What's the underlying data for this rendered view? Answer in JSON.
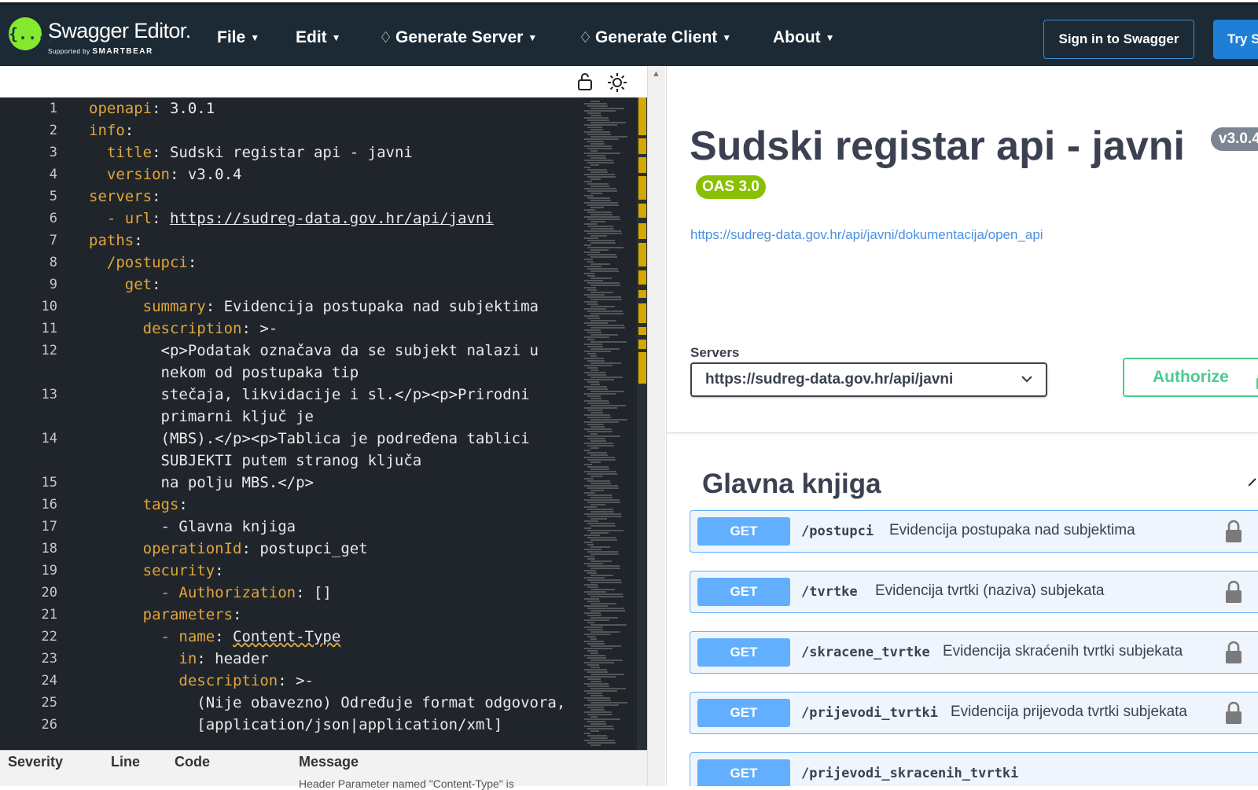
{
  "nav": {
    "logo_glyph": "{...}",
    "brand": "Swagger Editor.",
    "brand_sub": "Supported by",
    "brand_sub_bold": "SMARTBEAR",
    "items": [
      {
        "label": "File",
        "gem": ""
      },
      {
        "label": "Edit",
        "gem": ""
      },
      {
        "label": "Generate Server",
        "gem": "♢"
      },
      {
        "label": "Generate Client",
        "gem": "♢"
      },
      {
        "label": "About",
        "gem": ""
      }
    ],
    "signin": "Sign in to Swagger",
    "try": "Try S"
  },
  "editor": {
    "lock_icon": "unlock-icon",
    "theme_icon": "sun-icon",
    "lines": [
      {
        "n": "1",
        "indent": "",
        "key": "openapi",
        "rest": ": 3.0.1"
      },
      {
        "n": "2",
        "indent": "",
        "key": "info",
        "rest": ":"
      },
      {
        "n": "3",
        "indent": "  ",
        "key": "title",
        "rest": ": Sudski registar api - javni"
      },
      {
        "n": "4",
        "indent": "  ",
        "key": "version",
        "rest": ": v3.0.4"
      },
      {
        "n": "5",
        "indent": "",
        "key": "servers",
        "rest": ":"
      },
      {
        "n": "6",
        "indent": "  ",
        "key": "- url",
        "rest": ": ",
        "link": "https://sudreg-data.gov.hr/api/javni"
      },
      {
        "n": "7",
        "indent": "",
        "key": "paths",
        "rest": ":"
      },
      {
        "n": "8",
        "indent": "  ",
        "key": "/postupci",
        "rest": ":"
      },
      {
        "n": "9",
        "indent": "    ",
        "key": "get",
        "rest": ":"
      },
      {
        "n": "10",
        "indent": "      ",
        "key": "summary",
        "rest": ": Evidencija postupaka nad subjektima"
      },
      {
        "n": "11",
        "indent": "      ",
        "key": "description",
        "rest": ": >-"
      },
      {
        "n": "12",
        "indent": "        ",
        "key": "",
        "rest": "<p>Podatak označava da se subjekt nalazi u"
      },
      {
        "n": "",
        "indent": "        ",
        "key": "",
        "rest": "nekom od postupaka tip"
      },
      {
        "n": "13",
        "indent": "        ",
        "key": "",
        "rest": "stečaja, likvidacije i sl.</p><p>Prirodni"
      },
      {
        "n": "",
        "indent": "        ",
        "key": "",
        "rest": "primarni ključ je"
      },
      {
        "n": "14",
        "indent": "        ",
        "key": "",
        "rest": "(MBS).</p><p>Tablica je podređena tablici"
      },
      {
        "n": "",
        "indent": "        ",
        "key": "",
        "rest": "SUBJEKTI putem stranog ključa"
      },
      {
        "n": "15",
        "indent": "        ",
        "key": "",
        "rest": "na polju MBS.</p>"
      },
      {
        "n": "16",
        "indent": "      ",
        "key": "tags",
        "rest": ":"
      },
      {
        "n": "17",
        "indent": "        ",
        "key": "",
        "rest": "- Glavna knjiga"
      },
      {
        "n": "18",
        "indent": "      ",
        "key": "operationId",
        "rest": ": postupci_get"
      },
      {
        "n": "19",
        "indent": "      ",
        "key": "security",
        "rest": ":"
      },
      {
        "n": "20",
        "indent": "        ",
        "key": "- Authorization",
        "rest": ": []"
      },
      {
        "n": "21",
        "indent": "      ",
        "key": "parameters",
        "rest": ":"
      },
      {
        "n": "22",
        "indent": "        ",
        "key": "- name",
        "rest": ": ",
        "wavy": "Content-Type"
      },
      {
        "n": "23",
        "indent": "          ",
        "key": "in",
        "rest": ": header"
      },
      {
        "n": "24",
        "indent": "          ",
        "key": "description",
        "rest": ": >-"
      },
      {
        "n": "25",
        "indent": "            ",
        "key": "",
        "rest": "(Nije obavezno) Određuje format odgovora,"
      },
      {
        "n": "26",
        "indent": "            ",
        "key": "",
        "rest": "[application/json|application/xml]"
      }
    ]
  },
  "problems": {
    "headers": [
      "Severity",
      "Line",
      "Code",
      "Message"
    ],
    "message": "Header Parameter named \"Content-Type\" is"
  },
  "ui": {
    "title": "Sudski registar api - javni",
    "version": "v3.0.4",
    "oas": "OAS 3.0",
    "spec_link": "https://sudreg-data.gov.hr/api/javni/dokumentacija/open_api",
    "servers_label": "Servers",
    "server_value": "https://sudreg-data.gov.hr/api/javni",
    "authorize": "Authorize",
    "tag": "Glavna knjiga",
    "operations": [
      {
        "method": "GET",
        "path": "/postupci",
        "summary": "Evidencija postupaka nad subjektima"
      },
      {
        "method": "GET",
        "path": "/tvrtke",
        "summary": "Evidencija tvrtki (naziva) subjekata"
      },
      {
        "method": "GET",
        "path": "/skracene_tvrtke",
        "summary": "Evidencija skraćenih tvrtki subjekata"
      },
      {
        "method": "GET",
        "path": "/prijevodi_tvrtki",
        "summary": "Evidencija prijevoda tvrtki subjekata"
      },
      {
        "method": "GET",
        "path": "/prijevodi_skracenih_tvrtki",
        "summary": ""
      }
    ]
  },
  "colors": {
    "nav_bg": "#1b2a35",
    "editor_bg": "#20252b",
    "yaml_key": "#e0a63b",
    "get_method": "#61affe",
    "oas_badge": "#89bf04",
    "authorize": "#49cc90"
  }
}
